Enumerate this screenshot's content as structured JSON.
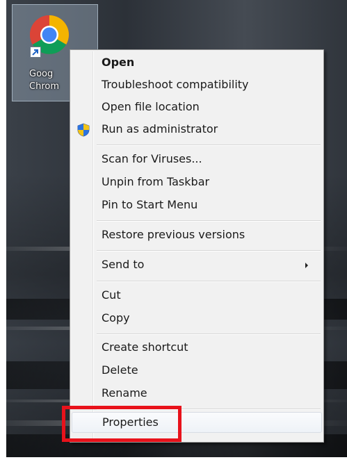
{
  "desktop": {
    "icon": {
      "name": "chrome-icon",
      "label_line1": "Goog",
      "label_line2": "Chrom",
      "overlay_icon": "shortcut-arrow-icon"
    }
  },
  "context_menu": {
    "items": [
      {
        "label": "Open",
        "bold": true
      },
      {
        "label": "Troubleshoot compatibility"
      },
      {
        "label": "Open file location"
      },
      {
        "label": "Run as administrator",
        "icon": "uac-shield-icon"
      },
      {
        "label": "Scan for Viruses..."
      },
      {
        "label": "Unpin from Taskbar"
      },
      {
        "label": "Pin to Start Menu"
      },
      {
        "label": "Restore previous versions"
      },
      {
        "label": "Send to",
        "has_submenu": true
      },
      {
        "label": "Cut"
      },
      {
        "label": "Copy"
      },
      {
        "label": "Create shortcut"
      },
      {
        "label": "Delete"
      },
      {
        "label": "Rename"
      },
      {
        "label": "Properties",
        "hovered": true,
        "highlighted": true
      }
    ]
  },
  "annotation": {
    "highlight_color": "#e8121b",
    "target": "Properties"
  },
  "colors": {
    "menu_background": "#f1f1f1",
    "menu_border": "#979797",
    "text": "#1a1a1a"
  }
}
